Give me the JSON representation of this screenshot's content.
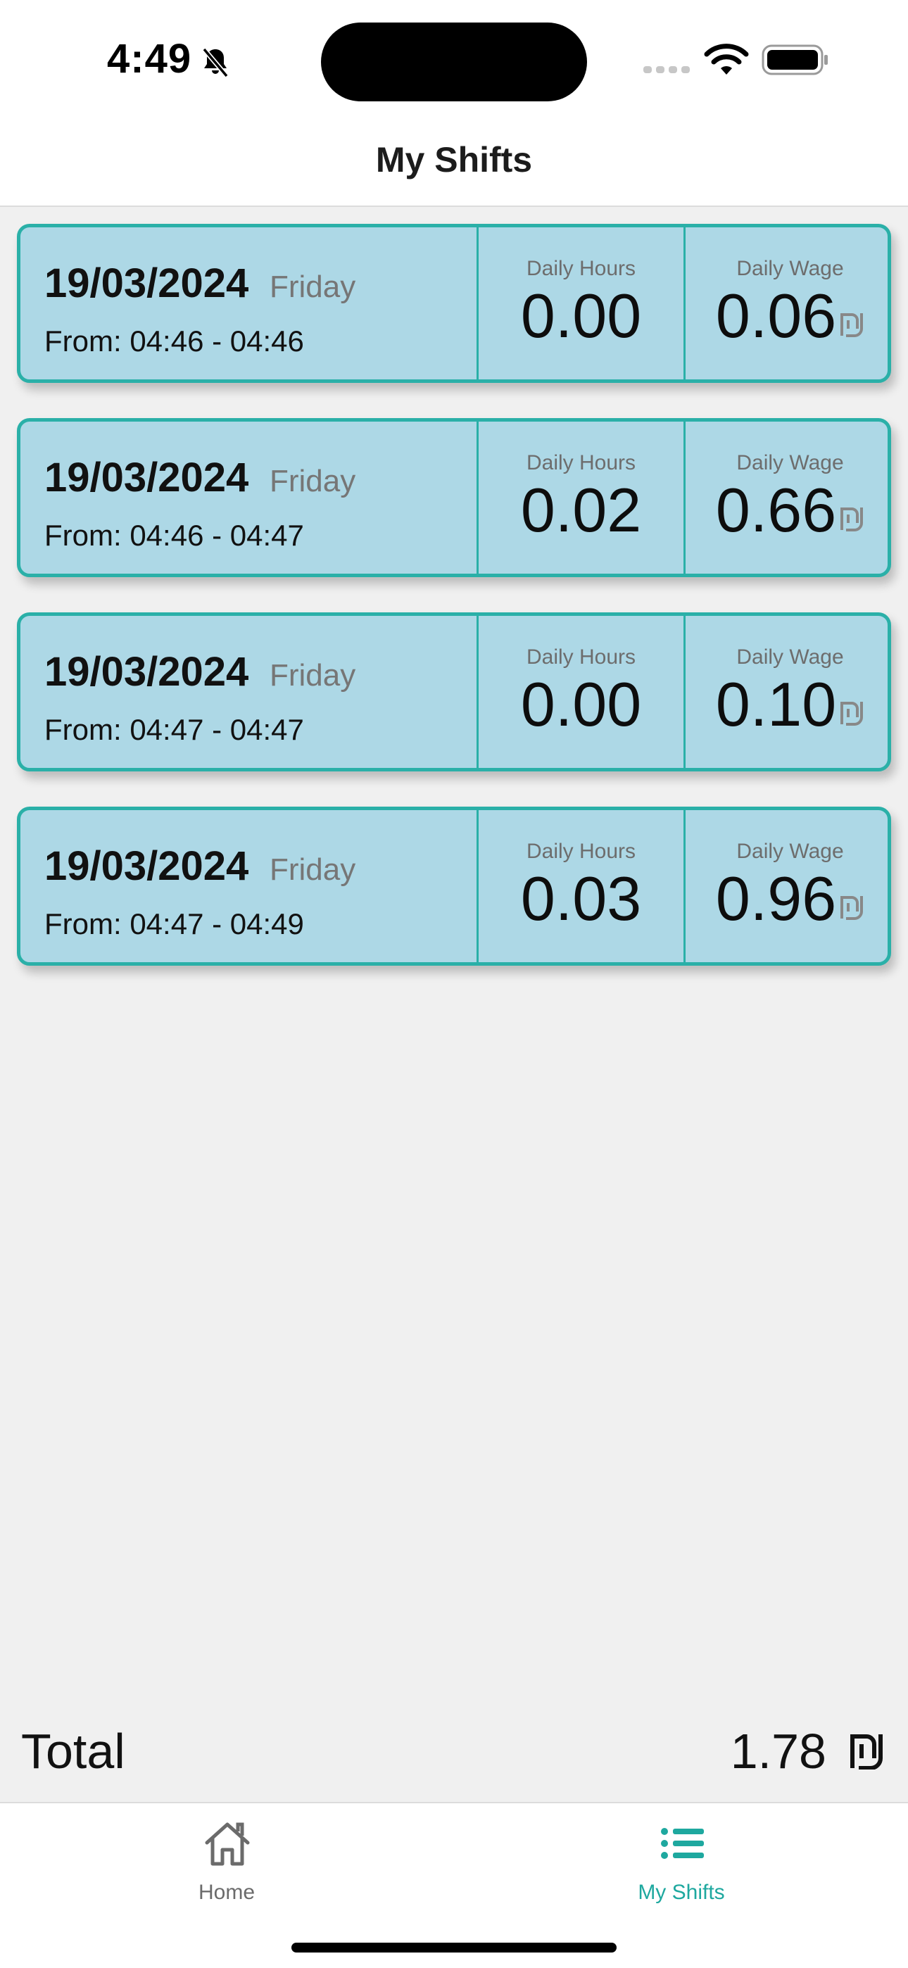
{
  "status_bar": {
    "time": "4:49",
    "icons": [
      "bell-slash-icon",
      "signal-icon",
      "wifi-icon",
      "battery-icon"
    ]
  },
  "header": {
    "title": "My Shifts"
  },
  "shifts": [
    {
      "date": "19/03/2024",
      "day": "Friday",
      "range": "From: 04:46 - 04:46",
      "hours_label": "Daily Hours",
      "hours": "0.00",
      "wage_label": "Daily Wage",
      "wage": "0.06"
    },
    {
      "date": "19/03/2024",
      "day": "Friday",
      "range": "From: 04:46 - 04:47",
      "hours_label": "Daily Hours",
      "hours": "0.02",
      "wage_label": "Daily Wage",
      "wage": "0.66"
    },
    {
      "date": "19/03/2024",
      "day": "Friday",
      "range": "From: 04:47 - 04:47",
      "hours_label": "Daily Hours",
      "hours": "0.00",
      "wage_label": "Daily Wage",
      "wage": "0.10"
    },
    {
      "date": "19/03/2024",
      "day": "Friday",
      "range": "From: 04:47 - 04:49",
      "hours_label": "Daily Hours",
      "hours": "0.03",
      "wage_label": "Daily Wage",
      "wage": "0.96"
    }
  ],
  "total": {
    "label": "Total",
    "value": "1.78",
    "currency_icon": "shekel-icon"
  },
  "tab_bar": {
    "tabs": [
      {
        "label": "Home",
        "icon": "home-icon",
        "active": false
      },
      {
        "label": "My Shifts",
        "icon": "list-icon",
        "active": true
      }
    ]
  },
  "colors": {
    "card_background": "#add8e6",
    "card_border": "#2ab0a8",
    "active_tab": "#1ea89f",
    "inactive_tab": "#6b6b6b",
    "page_background": "#f0f0f0"
  }
}
